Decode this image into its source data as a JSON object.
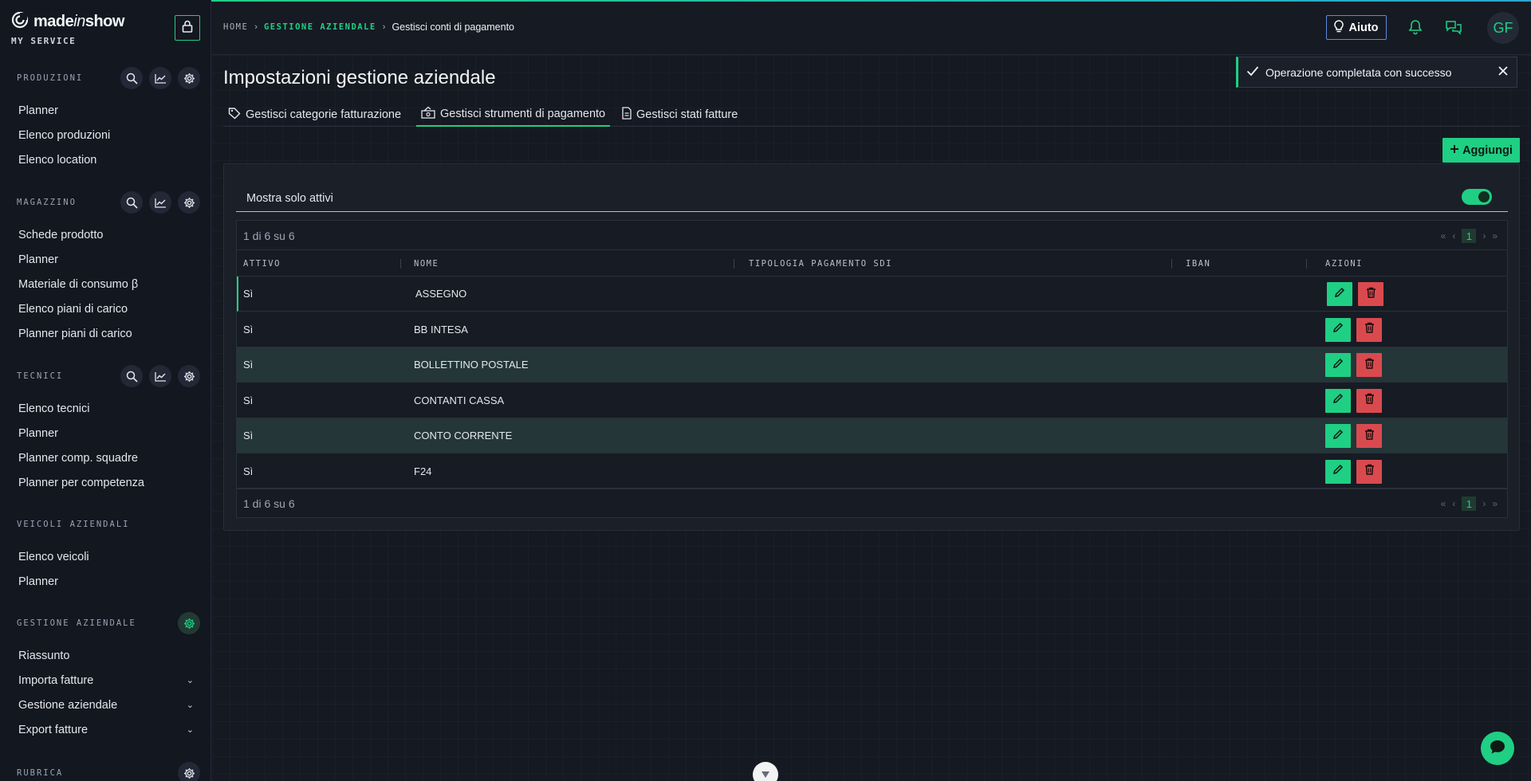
{
  "brand": {
    "name_prefix": "made",
    "name_italic": "in",
    "name_suffix": "show",
    "subtitle": "MY SERVICE"
  },
  "sidebar": {
    "sections": [
      {
        "title": "PRODUZIONI",
        "items": [
          "Planner",
          "Elenco produzioni",
          "Elenco location"
        ]
      },
      {
        "title": "MAGAZZINO",
        "items": [
          "Schede prodotto",
          "Planner",
          "Materiale di consumo β",
          "Elenco piani di carico",
          "Planner piani di carico"
        ]
      },
      {
        "title": "TECNICI",
        "items": [
          "Elenco tecnici",
          "Planner",
          "Planner comp. squadre",
          "Planner per competenza"
        ]
      },
      {
        "title": "VEICOLI AZIENDALI",
        "items": [
          "Elenco veicoli",
          "Planner"
        ]
      },
      {
        "title": "GESTIONE AZIENDALE",
        "items": [
          "Riassunto",
          "Importa fatture",
          "Gestione aziendale",
          "Export fatture"
        ]
      },
      {
        "title": "RUBRICA",
        "items": []
      }
    ]
  },
  "header": {
    "breadcrumb": {
      "home": "HOME",
      "section": "GESTIONE AZIENDALE",
      "current": "Gestisci conti di pagamento"
    },
    "help_label": "Aiuto",
    "avatar_initials": "GF"
  },
  "main": {
    "title": "Impostazioni gestione aziendale",
    "tabs": [
      {
        "label": "Gestisci categorie fatturazione",
        "icon": "tag-icon"
      },
      {
        "label": "Gestisci strumenti di pagamento",
        "icon": "payment-icon"
      },
      {
        "label": "Gestisci stati fatture",
        "icon": "invoice-icon"
      }
    ],
    "toast": "Operazione completata con successo",
    "add_label": "Aggiungi",
    "filter_label": "Mostra solo attivi",
    "pager_text": "1 di 6 su 6",
    "current_page": "1",
    "columns": [
      "ATTIVO",
      "NOME",
      "TIPOLOGIA PAGAMENTO SDI",
      "IBAN",
      "AZIONI"
    ],
    "rows": [
      {
        "attivo": "Sì",
        "nome": "ASSEGNO"
      },
      {
        "attivo": "Sì",
        "nome": "BB INTESA"
      },
      {
        "attivo": "Sì",
        "nome": "BOLLETTINO POSTALE"
      },
      {
        "attivo": "Sì",
        "nome": "CONTANTI CASSA"
      },
      {
        "attivo": "Sì",
        "nome": "CONTO CORRENTE"
      },
      {
        "attivo": "Sì",
        "nome": "F24"
      }
    ]
  },
  "colors": {
    "accent": "#1fcf84",
    "danger": "#d94a4f",
    "bg": "#151922"
  }
}
